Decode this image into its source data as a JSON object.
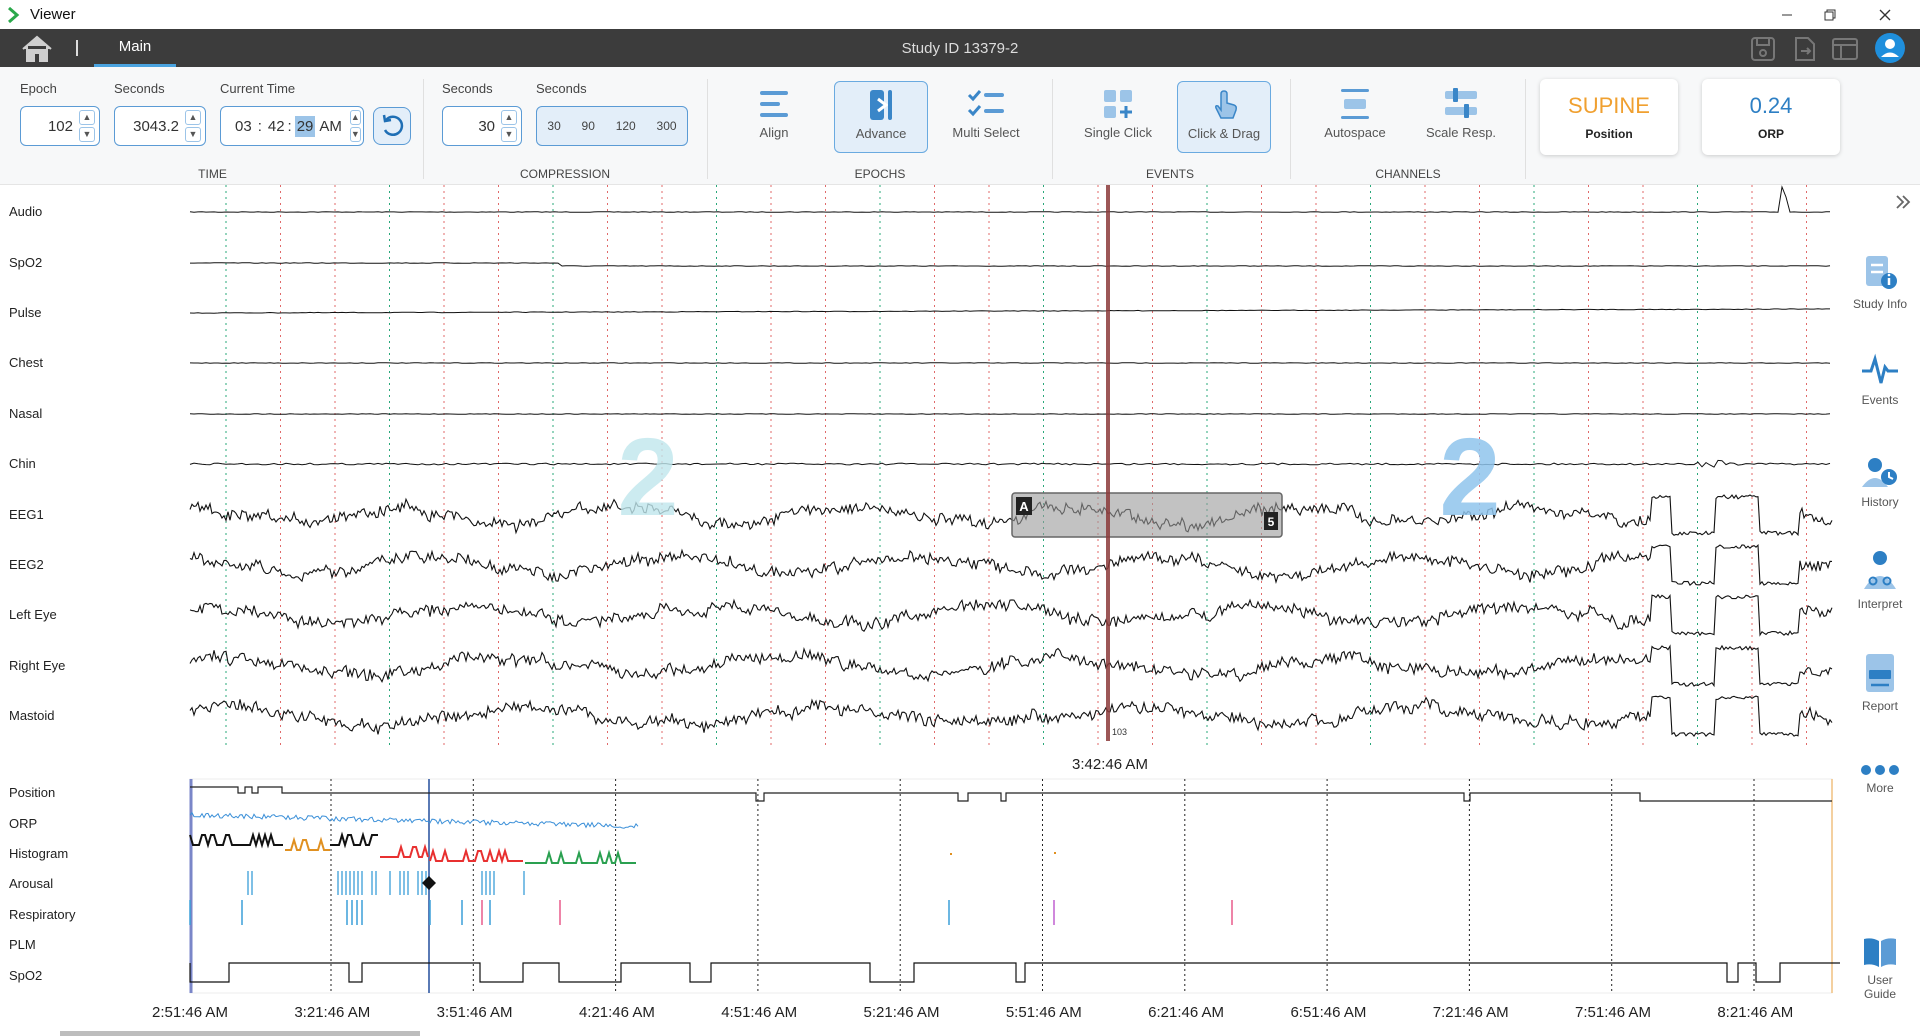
{
  "window": {
    "title": "Viewer"
  },
  "nav": {
    "tab_main": "Main",
    "study_id": "Study ID 13379-2"
  },
  "time_group": {
    "epoch_label": "Epoch",
    "epoch_value": "102",
    "seconds_label": "Seconds",
    "seconds_value": "3043.2",
    "current_time_label": "Current Time",
    "time_hh": "03",
    "time_mm": "42",
    "time_ss": "29",
    "time_ampm": "AM",
    "title": "TIME"
  },
  "compression": {
    "seconds_label_1": "Seconds",
    "seconds_value": "30",
    "seconds_label_2": "Seconds",
    "options": [
      "30",
      "90",
      "120",
      "300"
    ],
    "title": "COMPRESSION"
  },
  "epochs": {
    "align": "Align",
    "advance": "Advance",
    "multi_select": "Multi Select",
    "title": "EPOCHS"
  },
  "events": {
    "single_click": "Single Click",
    "click_drag": "Click & Drag",
    "title": "EVENTS"
  },
  "channels_group": {
    "autospace": "Autospace",
    "scale_resp": "Scale Resp.",
    "title": "CHANNELS"
  },
  "cards": {
    "position_value": "SUPINE",
    "position_label": "Position",
    "orp_value": "0.24",
    "orp_label": "ORP"
  },
  "channels": [
    "Audio",
    "SpO2",
    "Pulse",
    "Chest",
    "Nasal",
    "Chin",
    "EEG1",
    "EEG2",
    "Left Eye",
    "Right Eye",
    "Mastoid"
  ],
  "stage_labels": [
    "2",
    "2"
  ],
  "event_box": {
    "left_tag": "A",
    "right_tag": "5"
  },
  "cursor_time": "3:42:46 AM",
  "cursor_sublabel": "103",
  "overview_rows": [
    "Position",
    "ORP",
    "Histogram",
    "Arousal",
    "Respiratory",
    "PLM",
    "SpO2"
  ],
  "overview_axis": [
    "2:51:46 AM",
    "3:21:46 AM",
    "3:51:46 AM",
    "4:21:46 AM",
    "4:51:46 AM",
    "5:21:46 AM",
    "5:51:46 AM",
    "6:21:46 AM",
    "6:51:46 AM",
    "7:21:46 AM",
    "7:51:46 AM",
    "8:21:46 AM"
  ],
  "sidebar": {
    "study_info": "Study Info",
    "events": "Events",
    "history": "History",
    "interpret": "Interpret",
    "report": "Report",
    "more": "More",
    "user_guide_1": "User",
    "user_guide_2": "Guide"
  },
  "colors": {
    "accent": "#4aa3df",
    "navbar": "#3c3c3c",
    "cursor_line": "#8b3a3a",
    "supine": "#f0a030",
    "orp": "#2d7fc4",
    "stage_label": "#a8d8ea"
  }
}
